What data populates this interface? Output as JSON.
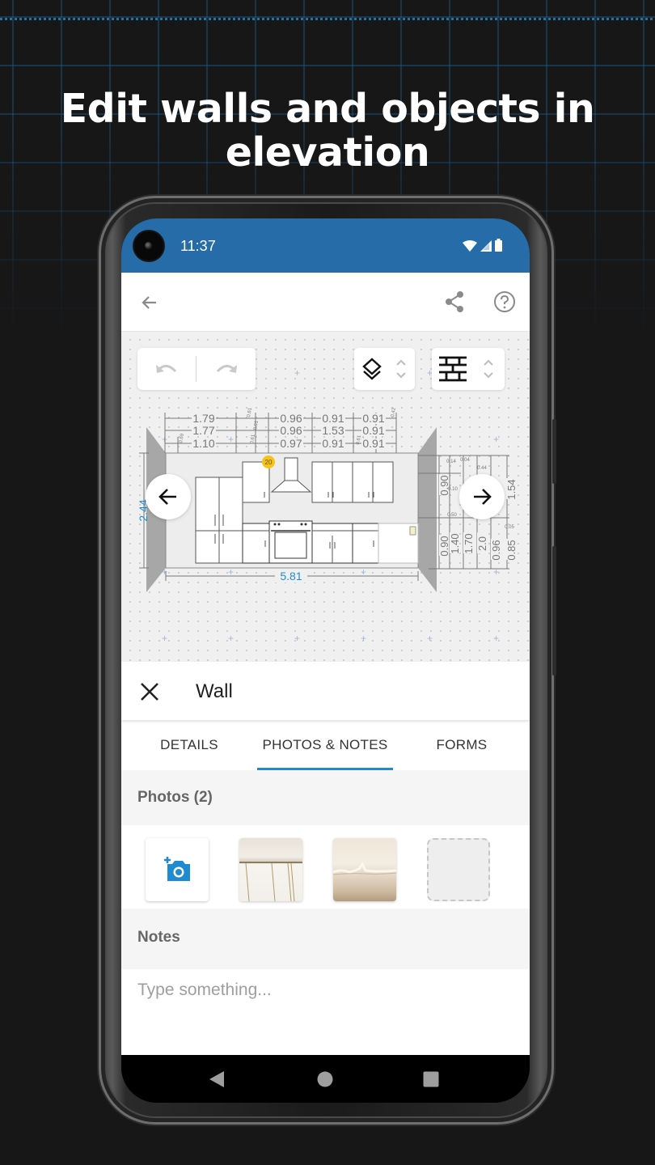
{
  "headline": {
    "line1": "Edit walls and objects in",
    "line2": "elevation"
  },
  "status_bar": {
    "time": "11:37",
    "icons": [
      "wifi-icon",
      "signal-icon",
      "battery-icon"
    ],
    "color": "#256ca8"
  },
  "app_bar": {
    "back_icon": "arrow-left-icon",
    "share_icon": "share-icon",
    "help_icon": "help-circle-icon"
  },
  "canvas_toolbar": {
    "undo_icon": "undo-icon",
    "redo_icon": "redo-icon",
    "layers_icon": "layers-icon",
    "layers_stepper": "chevron-up-down-icon",
    "wall_material_icon": "brick-wall-icon",
    "material_stepper": "chevron-up-down-icon"
  },
  "elevation": {
    "wall_height": "2.44",
    "wall_width": "5.81",
    "badge": "20",
    "top_dimensions": {
      "row1": [
        "1.79",
        "0.96",
        "0.91",
        "0.91"
      ],
      "row2": [
        "1.77",
        "0.96",
        "1.53",
        "0.91"
      ],
      "row3": [
        "1.10",
        "0.97",
        "0.91",
        "0.91"
      ]
    },
    "small_labels": [
      "0.69",
      "0.61",
      "0.61",
      "0.61",
      "0.61",
      "0.42"
    ],
    "side_dimensions": [
      "0.90",
      "0.90",
      "1.40",
      "1.70",
      "2.0",
      "0.96",
      "0.85",
      "1.54"
    ],
    "side_small_labels": [
      "0.14",
      "0.04",
      "0.44",
      "0.10",
      "0.50",
      "0.05"
    ],
    "accent_color": "#1e8bd0"
  },
  "nav_arrows": {
    "prev_icon": "arrow-left-icon",
    "next_icon": "arrow-right-icon"
  },
  "sheet": {
    "close_icon": "close-icon",
    "title": "Wall"
  },
  "tabs": [
    {
      "label": "DETAILS",
      "active": false
    },
    {
      "label": "PHOTOS & NOTES",
      "active": true
    },
    {
      "label": "FORMS",
      "active": false
    }
  ],
  "photos": {
    "heading": "Photos (2)",
    "add_icon": "add-photo-camera-icon",
    "items": [
      "photo-ceiling-cracks",
      "photo-water-damage"
    ],
    "placeholder_slot": "empty-photo-slot"
  },
  "notes": {
    "heading": "Notes",
    "placeholder": "Type something...",
    "value": ""
  },
  "system_nav": {
    "back": "nav-back-icon",
    "home": "nav-home-icon",
    "recents": "nav-recents-icon"
  }
}
